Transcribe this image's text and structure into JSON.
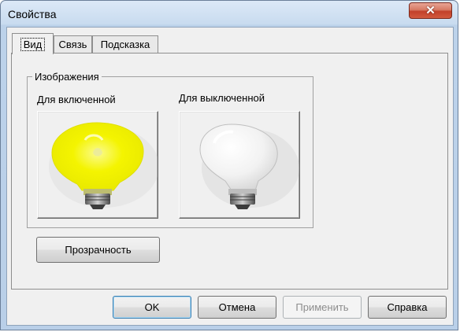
{
  "window": {
    "title": "Свойства",
    "close_glyph": "✕"
  },
  "tabs": [
    {
      "label": "Вид",
      "active": true
    },
    {
      "label": "Связь",
      "active": false
    },
    {
      "label": "Подсказка",
      "active": false
    }
  ],
  "images_group": {
    "legend": "Изображения",
    "on_label": "Для включенной",
    "off_label": "Для выключенной",
    "on_image_icon": "lightbulb-on-icon",
    "off_image_icon": "lightbulb-off-icon"
  },
  "transparency_button": "Прозрачность",
  "footer": {
    "ok": "OK",
    "cancel": "Отмена",
    "apply": "Применить",
    "help": "Справка"
  },
  "colors": {
    "bulb_on": "#f2f200",
    "bulb_off": "#f4f4f4",
    "close_button": "#c2402a",
    "frame": "#b9cfe8"
  }
}
